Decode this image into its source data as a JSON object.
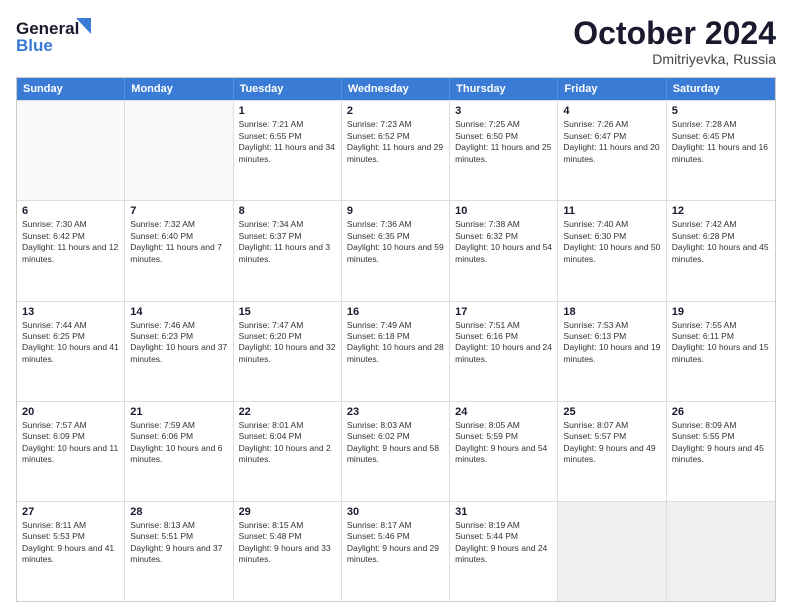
{
  "logo": {
    "line1": "General",
    "line2": "Blue"
  },
  "title": "October 2024",
  "subtitle": "Dmitriyevka, Russia",
  "header_days": [
    "Sunday",
    "Monday",
    "Tuesday",
    "Wednesday",
    "Thursday",
    "Friday",
    "Saturday"
  ],
  "weeks": [
    [
      {
        "day": "",
        "sunrise": "",
        "sunset": "",
        "daylight": ""
      },
      {
        "day": "",
        "sunrise": "",
        "sunset": "",
        "daylight": ""
      },
      {
        "day": "1",
        "sunrise": "Sunrise: 7:21 AM",
        "sunset": "Sunset: 6:55 PM",
        "daylight": "Daylight: 11 hours and 34 minutes."
      },
      {
        "day": "2",
        "sunrise": "Sunrise: 7:23 AM",
        "sunset": "Sunset: 6:52 PM",
        "daylight": "Daylight: 11 hours and 29 minutes."
      },
      {
        "day": "3",
        "sunrise": "Sunrise: 7:25 AM",
        "sunset": "Sunset: 6:50 PM",
        "daylight": "Daylight: 11 hours and 25 minutes."
      },
      {
        "day": "4",
        "sunrise": "Sunrise: 7:26 AM",
        "sunset": "Sunset: 6:47 PM",
        "daylight": "Daylight: 11 hours and 20 minutes."
      },
      {
        "day": "5",
        "sunrise": "Sunrise: 7:28 AM",
        "sunset": "Sunset: 6:45 PM",
        "daylight": "Daylight: 11 hours and 16 minutes."
      }
    ],
    [
      {
        "day": "6",
        "sunrise": "Sunrise: 7:30 AM",
        "sunset": "Sunset: 6:42 PM",
        "daylight": "Daylight: 11 hours and 12 minutes."
      },
      {
        "day": "7",
        "sunrise": "Sunrise: 7:32 AM",
        "sunset": "Sunset: 6:40 PM",
        "daylight": "Daylight: 11 hours and 7 minutes."
      },
      {
        "day": "8",
        "sunrise": "Sunrise: 7:34 AM",
        "sunset": "Sunset: 6:37 PM",
        "daylight": "Daylight: 11 hours and 3 minutes."
      },
      {
        "day": "9",
        "sunrise": "Sunrise: 7:36 AM",
        "sunset": "Sunset: 6:35 PM",
        "daylight": "Daylight: 10 hours and 59 minutes."
      },
      {
        "day": "10",
        "sunrise": "Sunrise: 7:38 AM",
        "sunset": "Sunset: 6:32 PM",
        "daylight": "Daylight: 10 hours and 54 minutes."
      },
      {
        "day": "11",
        "sunrise": "Sunrise: 7:40 AM",
        "sunset": "Sunset: 6:30 PM",
        "daylight": "Daylight: 10 hours and 50 minutes."
      },
      {
        "day": "12",
        "sunrise": "Sunrise: 7:42 AM",
        "sunset": "Sunset: 6:28 PM",
        "daylight": "Daylight: 10 hours and 45 minutes."
      }
    ],
    [
      {
        "day": "13",
        "sunrise": "Sunrise: 7:44 AM",
        "sunset": "Sunset: 6:25 PM",
        "daylight": "Daylight: 10 hours and 41 minutes."
      },
      {
        "day": "14",
        "sunrise": "Sunrise: 7:46 AM",
        "sunset": "Sunset: 6:23 PM",
        "daylight": "Daylight: 10 hours and 37 minutes."
      },
      {
        "day": "15",
        "sunrise": "Sunrise: 7:47 AM",
        "sunset": "Sunset: 6:20 PM",
        "daylight": "Daylight: 10 hours and 32 minutes."
      },
      {
        "day": "16",
        "sunrise": "Sunrise: 7:49 AM",
        "sunset": "Sunset: 6:18 PM",
        "daylight": "Daylight: 10 hours and 28 minutes."
      },
      {
        "day": "17",
        "sunrise": "Sunrise: 7:51 AM",
        "sunset": "Sunset: 6:16 PM",
        "daylight": "Daylight: 10 hours and 24 minutes."
      },
      {
        "day": "18",
        "sunrise": "Sunrise: 7:53 AM",
        "sunset": "Sunset: 6:13 PM",
        "daylight": "Daylight: 10 hours and 19 minutes."
      },
      {
        "day": "19",
        "sunrise": "Sunrise: 7:55 AM",
        "sunset": "Sunset: 6:11 PM",
        "daylight": "Daylight: 10 hours and 15 minutes."
      }
    ],
    [
      {
        "day": "20",
        "sunrise": "Sunrise: 7:57 AM",
        "sunset": "Sunset: 6:09 PM",
        "daylight": "Daylight: 10 hours and 11 minutes."
      },
      {
        "day": "21",
        "sunrise": "Sunrise: 7:59 AM",
        "sunset": "Sunset: 6:06 PM",
        "daylight": "Daylight: 10 hours and 6 minutes."
      },
      {
        "day": "22",
        "sunrise": "Sunrise: 8:01 AM",
        "sunset": "Sunset: 6:04 PM",
        "daylight": "Daylight: 10 hours and 2 minutes."
      },
      {
        "day": "23",
        "sunrise": "Sunrise: 8:03 AM",
        "sunset": "Sunset: 6:02 PM",
        "daylight": "Daylight: 9 hours and 58 minutes."
      },
      {
        "day": "24",
        "sunrise": "Sunrise: 8:05 AM",
        "sunset": "Sunset: 5:59 PM",
        "daylight": "Daylight: 9 hours and 54 minutes."
      },
      {
        "day": "25",
        "sunrise": "Sunrise: 8:07 AM",
        "sunset": "Sunset: 5:57 PM",
        "daylight": "Daylight: 9 hours and 49 minutes."
      },
      {
        "day": "26",
        "sunrise": "Sunrise: 8:09 AM",
        "sunset": "Sunset: 5:55 PM",
        "daylight": "Daylight: 9 hours and 45 minutes."
      }
    ],
    [
      {
        "day": "27",
        "sunrise": "Sunrise: 8:11 AM",
        "sunset": "Sunset: 5:53 PM",
        "daylight": "Daylight: 9 hours and 41 minutes."
      },
      {
        "day": "28",
        "sunrise": "Sunrise: 8:13 AM",
        "sunset": "Sunset: 5:51 PM",
        "daylight": "Daylight: 9 hours and 37 minutes."
      },
      {
        "day": "29",
        "sunrise": "Sunrise: 8:15 AM",
        "sunset": "Sunset: 5:48 PM",
        "daylight": "Daylight: 9 hours and 33 minutes."
      },
      {
        "day": "30",
        "sunrise": "Sunrise: 8:17 AM",
        "sunset": "Sunset: 5:46 PM",
        "daylight": "Daylight: 9 hours and 29 minutes."
      },
      {
        "day": "31",
        "sunrise": "Sunrise: 8:19 AM",
        "sunset": "Sunset: 5:44 PM",
        "daylight": "Daylight: 9 hours and 24 minutes."
      },
      {
        "day": "",
        "sunrise": "",
        "sunset": "",
        "daylight": ""
      },
      {
        "day": "",
        "sunrise": "",
        "sunset": "",
        "daylight": ""
      }
    ]
  ]
}
